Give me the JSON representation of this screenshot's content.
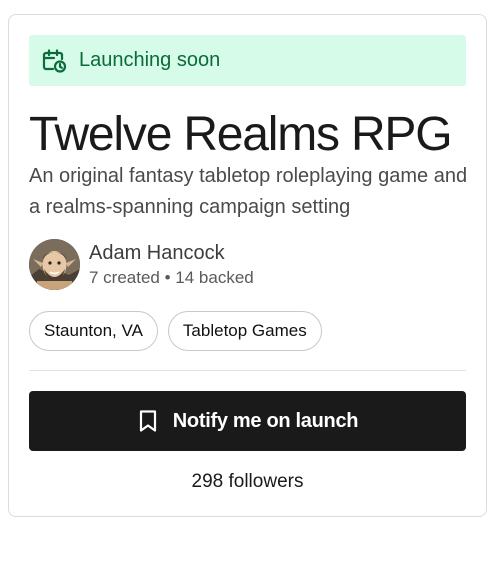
{
  "banner": {
    "label": "Launching soon",
    "icon": "calendar-clock-icon",
    "color": "#0b6b3a",
    "background": "#d6fbe8"
  },
  "project": {
    "title": "Twelve Realms RPG",
    "subtitle": "An original fantasy tabletop roleplaying game and a realms-spanning campaign setting"
  },
  "creator": {
    "name": "Adam Hancock",
    "stats": "7 created • 14 backed",
    "avatar": "avatar-elf-illustration"
  },
  "tags": [
    {
      "label": "Staunton, VA"
    },
    {
      "label": "Tabletop Games"
    }
  ],
  "actions": {
    "notify_label": "Notify me on launch",
    "notify_icon": "bookmark-icon"
  },
  "stats": {
    "followers": "298 followers"
  }
}
